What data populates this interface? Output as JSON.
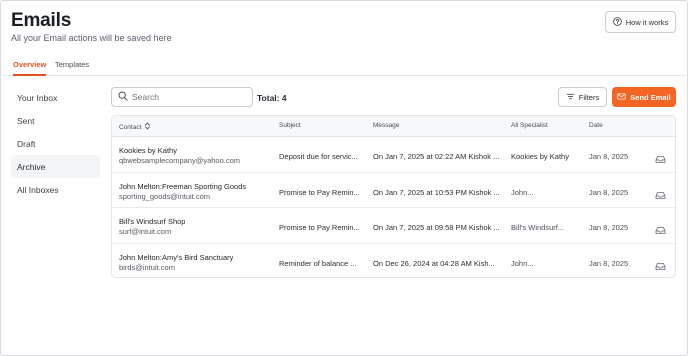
{
  "page": {
    "title": "Emails",
    "subtitle": "All your Email actions will be saved here",
    "how_it_works": "How it works"
  },
  "tabs": [
    {
      "label": "Overview",
      "active": true
    },
    {
      "label": "Templates",
      "active": false
    }
  ],
  "sidebar": {
    "items": [
      {
        "label": "Your Inbox",
        "active": false
      },
      {
        "label": "Sent",
        "active": false
      },
      {
        "label": "Draft",
        "active": false
      },
      {
        "label": "Archive",
        "active": true
      },
      {
        "label": "All Inboxes",
        "active": false
      }
    ]
  },
  "toolbar": {
    "search_placeholder": "Search",
    "total": "Total: 4",
    "filters_label": "Filters",
    "send_label": "Send Email"
  },
  "table": {
    "headers": {
      "contact": "Contact",
      "subject": "Subject",
      "message": "Message",
      "specialist": "All Specialist",
      "date": "Date"
    },
    "rows": [
      {
        "contact_name": "Kookies by Kathy",
        "contact_email": "qbwebsamplecompany@yahoo.com",
        "subject": "Deposit due for servic...",
        "message": "On Jan 7, 2025 at 02:22 AM Kishok ...",
        "specialist": "Kookies by Kathy",
        "date": "Jan 8, 2025"
      },
      {
        "contact_name": "John Melton:Freeman Sporting Goods",
        "contact_email": "sporting_goods@intuit.com",
        "subject": "Promise to Pay Remin...",
        "message": "On Jan 7, 2025 at 10:53 PM Kishok ...",
        "specialist": "John...",
        "date": "Jan 8, 2025"
      },
      {
        "contact_name": "Bill's Windsurf Shop",
        "contact_email": "surf@intuit.com",
        "subject": "Promise to Pay Remin...",
        "message": "On Jan 7, 2025 at 09:58 PM Kishok ...",
        "specialist": "Bill's Windsurf...",
        "date": "Jan 8, 2025"
      },
      {
        "contact_name": "John Melton:Amy's Bird Sanctuary",
        "contact_email": "birds@intuit.com",
        "subject": "Reminder of balance ...",
        "message": "On Dec 26, 2024 at 04:28 AM Kish...",
        "specialist": "John...",
        "date": "Jan 8, 2025"
      }
    ]
  },
  "colors": {
    "accent": "#f26522",
    "tab_active": "#e8511f"
  }
}
